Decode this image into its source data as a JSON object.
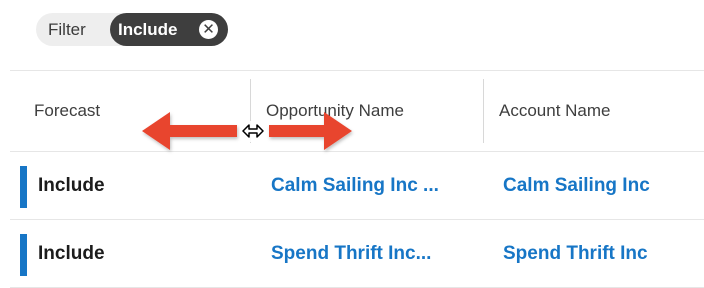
{
  "filter": {
    "label": "Filter",
    "tag_label": "Include",
    "remove_glyph": "✕"
  },
  "table": {
    "columns": [
      "Forecast",
      "Opportunity Name",
      "Account Name"
    ],
    "rows": [
      {
        "forecast": "Include",
        "opportunity": "Calm Sailing Inc ...",
        "account": "Calm Sailing Inc"
      },
      {
        "forecast": "Include",
        "opportunity": "Spend Thrift Inc...",
        "account": "Spend Thrift Inc"
      }
    ]
  },
  "annotation": {
    "arrow_color": "#e8442f",
    "cursor_icon": "resize-horizontal-cursor-icon"
  },
  "colors": {
    "link": "#1776c6",
    "accent": "#1776c6",
    "tag_bg": "#3e3e3e"
  }
}
